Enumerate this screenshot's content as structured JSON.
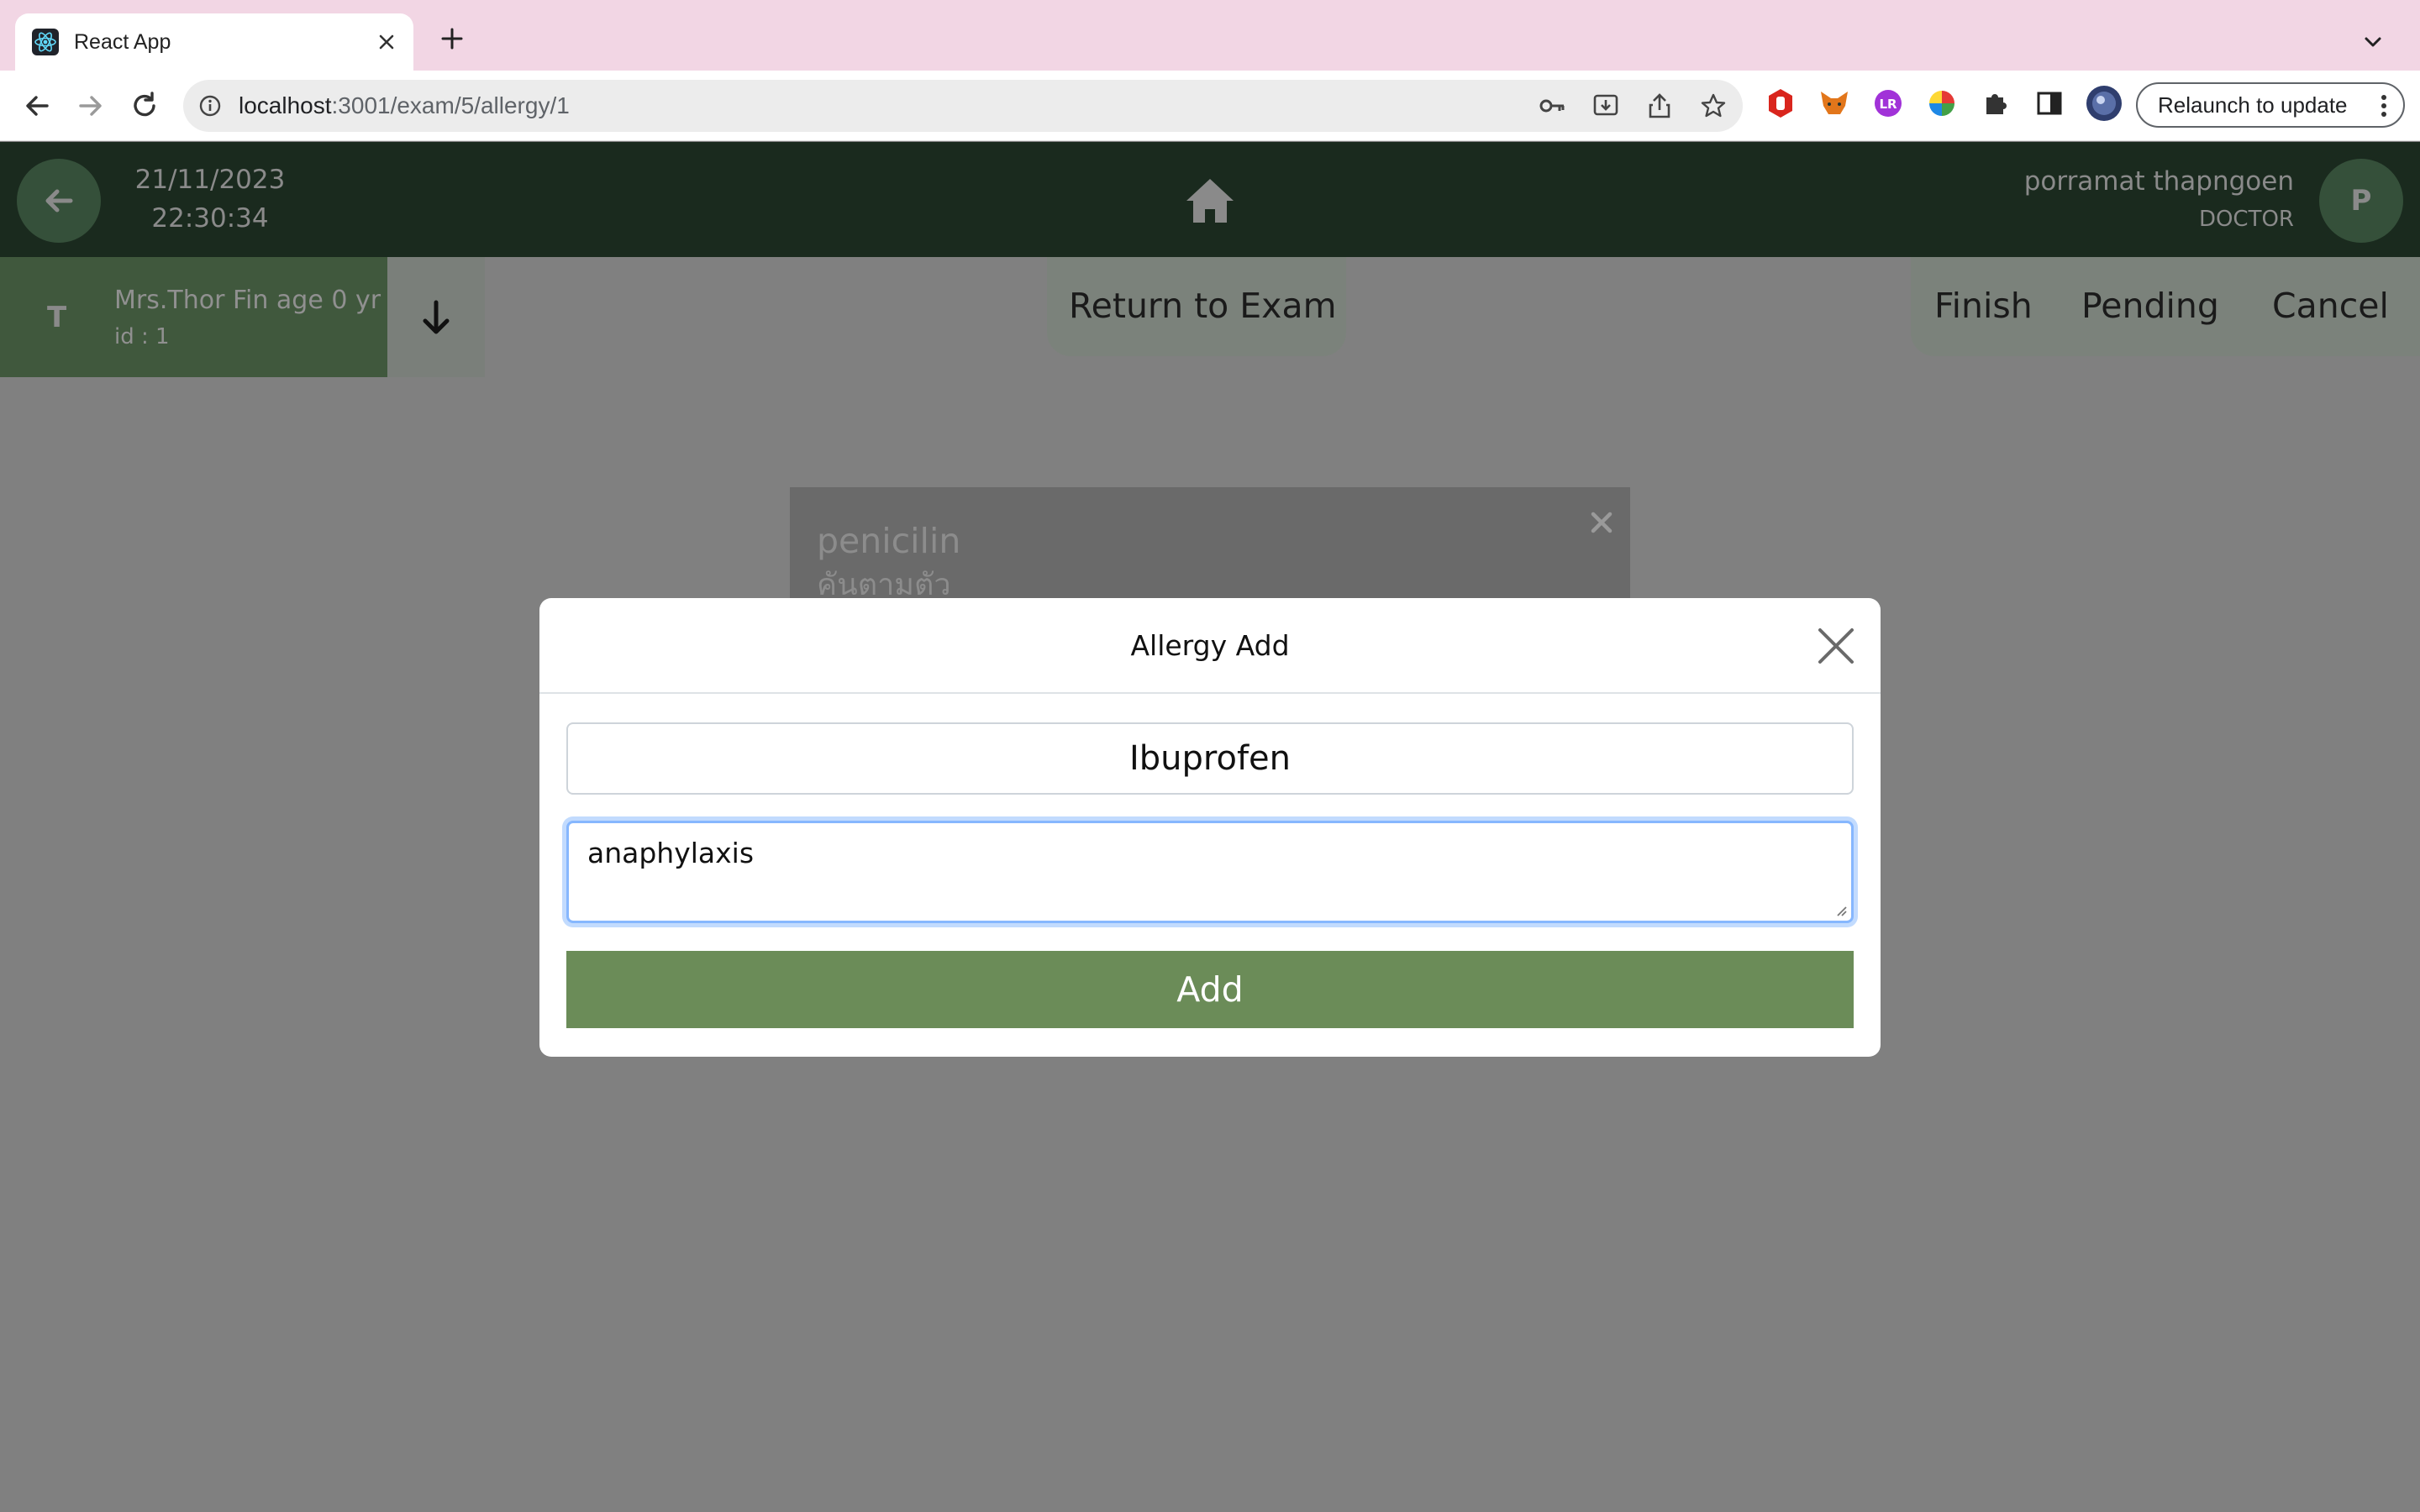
{
  "browser": {
    "tab_title": "React App",
    "url_host": "localhost",
    "url_path": ":3001/exam/5/allergy/1",
    "relaunch_label": "Relaunch to update",
    "icons": {
      "favicon": "react-icon",
      "tab_close": "close-icon",
      "new_tab": "plus-icon",
      "tab_search": "chevron-down-icon",
      "back": "arrow-left-icon",
      "forward": "arrow-right-icon",
      "reload": "reload-icon",
      "site_info": "info-icon",
      "passwords": "key-icon",
      "install": "install-icon",
      "share": "share-icon",
      "bookmark": "star-icon",
      "extensions": [
        "hand-stop-icon",
        "fox-icon",
        "lr-icon",
        "color-wheel-icon",
        "puzzle-icon",
        "sidepanel-icon"
      ],
      "profile": "profile-avatar-icon",
      "menu": "kebab-menu-icon"
    }
  },
  "header": {
    "date": "21/11/2023",
    "time": "22:30:34",
    "user_name": "porramat thapngoen",
    "user_role": "DOCTOR",
    "avatar_initial": "P",
    "icons": {
      "back": "arrow-left-icon",
      "home": "home-icon"
    }
  },
  "patient": {
    "initial": "T",
    "name_line": "Mrs.Thor Fin age 0 yr",
    "id_line": "id : 1",
    "expand_icon": "arrow-down-icon"
  },
  "actions": {
    "return_to_exam": "Return to Exam",
    "finish": "Finish",
    "pending": "Pending",
    "cancel": "Cancel"
  },
  "background_card": {
    "title": "penicilin",
    "subtitle": "คันตามตัว",
    "close_icon": "close-icon"
  },
  "modal": {
    "title": "Allergy Add",
    "close_icon": "close-icon",
    "drug_name_value": "Ibuprofen",
    "reaction_value": "anaphylaxis",
    "add_label": "Add"
  },
  "colors": {
    "header_bg": "#1a2a1e",
    "patient_card_bg": "#40583d",
    "add_button": "#6b8c58",
    "overlay": "#808080",
    "focus_ring": "#86b7fe",
    "tab_strip": "#f2d6e4"
  }
}
